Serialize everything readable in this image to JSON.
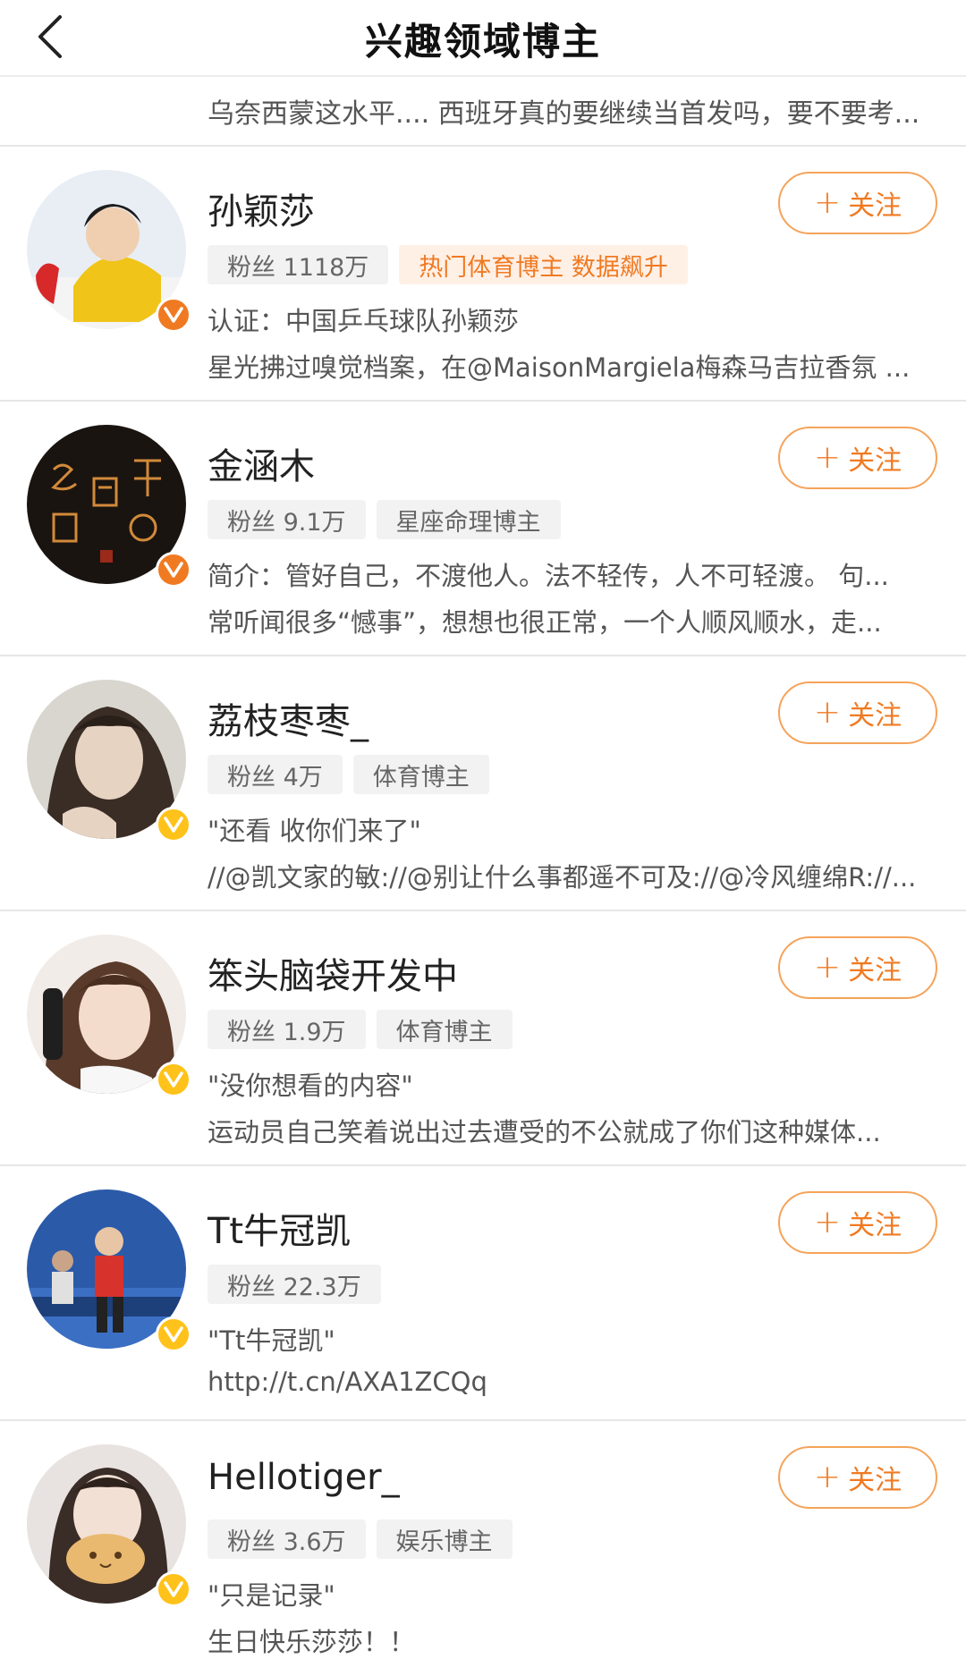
{
  "header": {
    "title": "兴趣领域博主"
  },
  "top_snippet": "乌奈西蒙这水平.... 西班牙真的要继续当首发吗，要不要考...",
  "follow_label": "关注",
  "follow_plus": "+",
  "users": [
    {
      "name": "孙颖莎",
      "fans": "粉丝 1118万",
      "tags": [
        "热门体育博主 数据飙升"
      ],
      "hot_tag": true,
      "line1": "认证：中国乒乓球队孙颖莎",
      "line2": "星光拂过嗅觉档案，在@MaisonMargiela梅森马吉拉香氛 ...",
      "badge": "orange"
    },
    {
      "name": "金涵木",
      "fans": "粉丝 9.1万",
      "tags": [
        "星座命理博主"
      ],
      "line1": "简介：管好自己，不渡他人。法不轻传，人不可轻渡。 句...",
      "line2": "常听闻很多“憾事”，想想也很正常，一个人顺风顺水，走...",
      "badge": "orange"
    },
    {
      "name": "荔枝枣枣_",
      "fans": "粉丝 4万",
      "tags": [
        "体育博主"
      ],
      "line1": "\"还看 收你们来了\"",
      "line2": "//@凯文家的敏://@别让什么事都遥不可及://@冷风缠绵R://...",
      "badge": "yellow"
    },
    {
      "name": "笨头脑袋开发中",
      "fans": "粉丝 1.9万",
      "tags": [
        "体育博主"
      ],
      "line1": "\"没你想看的内容\"",
      "line2": "运动员自己笑着说出过去遭受的不公就成了你们这种媒体...",
      "badge": "yellow"
    },
    {
      "name": "Tt牛冠凯",
      "fans": "粉丝 22.3万",
      "tags": [],
      "line1": "\"Tt牛冠凯\"",
      "line2": "http://t.cn/AXA1ZCQq",
      "badge": "yellow"
    },
    {
      "name": "Hellotiger_",
      "fans": "粉丝 3.6万",
      "tags": [
        "娱乐博主"
      ],
      "line1": "\"只是记录\"",
      "line2": "生日快乐莎莎！！",
      "badge": "yellow"
    }
  ]
}
